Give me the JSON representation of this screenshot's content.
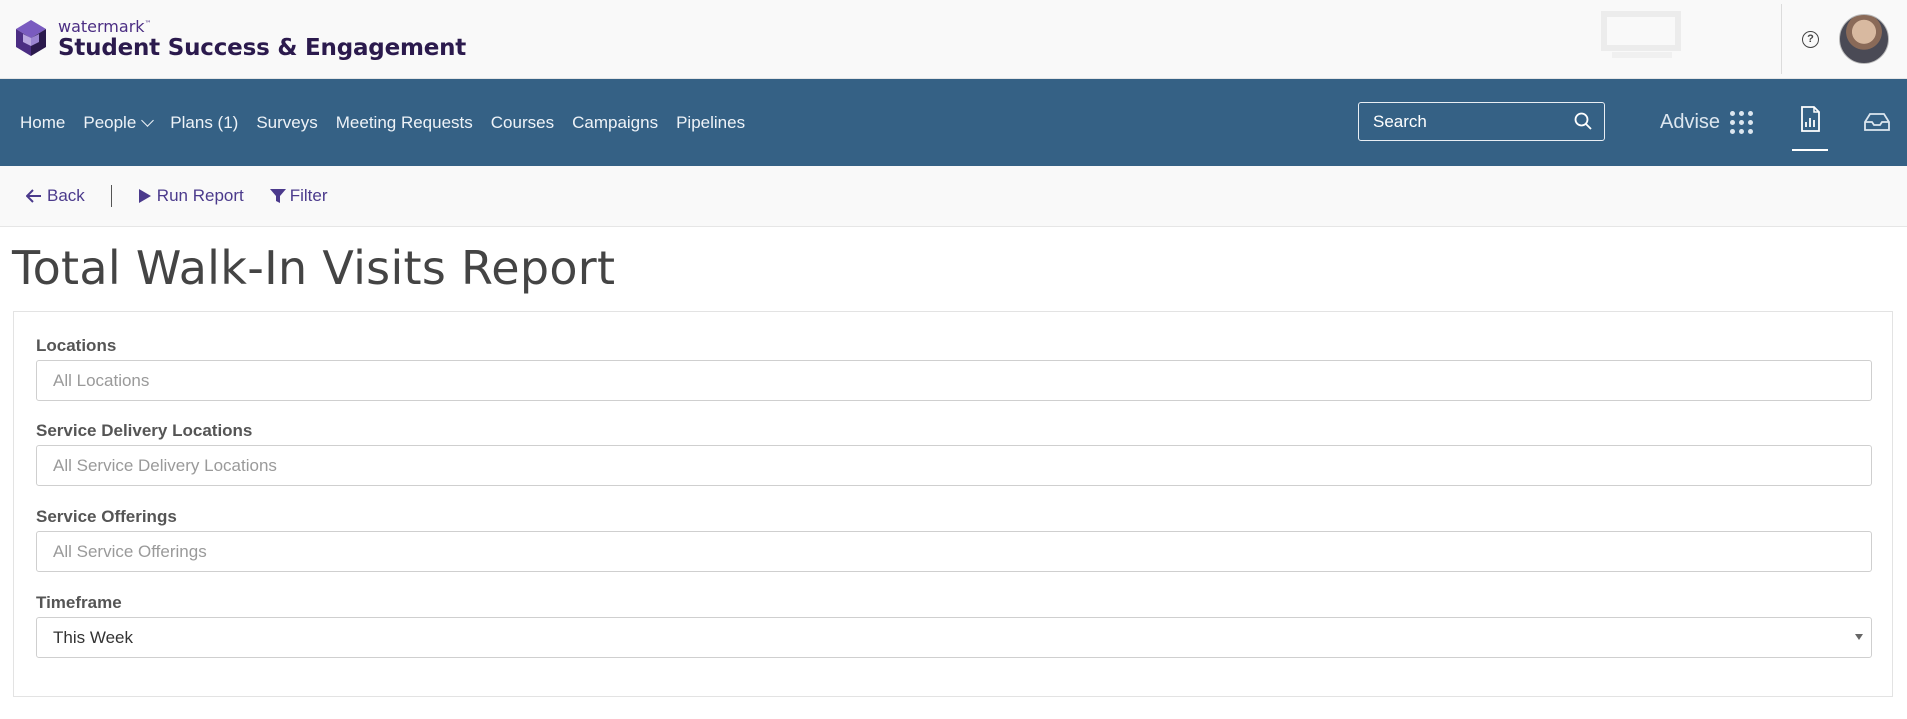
{
  "brand": {
    "small_text": "watermark",
    "trademark": "™",
    "product_name": "Student Success & Engagement",
    "colors": {
      "primary": "#4b2d83",
      "nav": "#356185"
    }
  },
  "header_icons": {
    "help": "help-circle-icon",
    "avatar": "user-avatar"
  },
  "nav": {
    "items": [
      {
        "label": "Home"
      },
      {
        "label": "People"
      },
      {
        "label": "Plans (1)"
      },
      {
        "label": "Surveys"
      },
      {
        "label": "Meeting Requests"
      },
      {
        "label": "Courses"
      },
      {
        "label": "Campaigns"
      },
      {
        "label": "Pipelines"
      }
    ],
    "search_placeholder": "Search",
    "advise_label": "Advise"
  },
  "actions": {
    "back": "Back",
    "run_report": "Run Report",
    "filter": "Filter"
  },
  "page": {
    "title": "Total Walk-In Visits Report"
  },
  "form": {
    "fields": [
      {
        "label": "Locations",
        "placeholder": "All Locations"
      },
      {
        "label": "Service Delivery Locations",
        "placeholder": "All Service Delivery Locations"
      },
      {
        "label": "Service Offerings",
        "placeholder": "All Service Offerings"
      },
      {
        "label": "Timeframe",
        "value": "This Week"
      }
    ]
  }
}
